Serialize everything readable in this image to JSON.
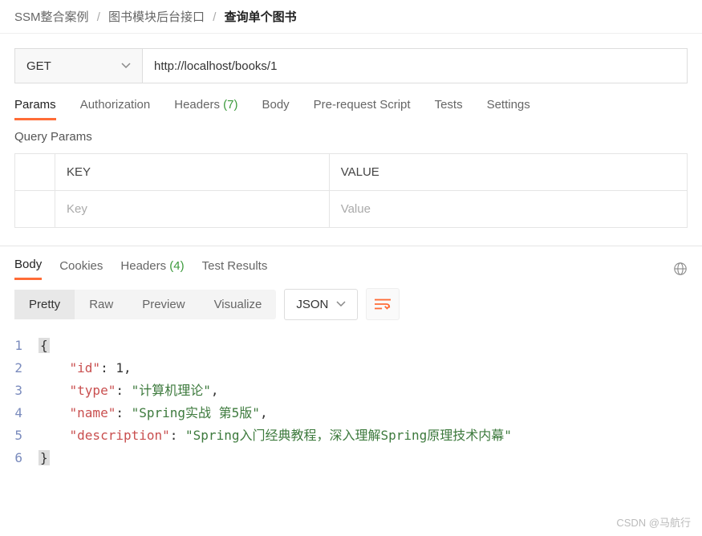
{
  "breadcrumb": {
    "level1": "SSM整合案例",
    "level2": "图书模块后台接口",
    "current": "查询单个图书"
  },
  "request": {
    "method": "GET",
    "url": "http://localhost/books/1"
  },
  "reqTabs": {
    "params": "Params",
    "auth": "Authorization",
    "headers": "Headers",
    "headers_count": "(7)",
    "body": "Body",
    "prereq": "Pre-request Script",
    "tests": "Tests",
    "settings": "Settings"
  },
  "sectionLabel": "Query Params",
  "paramsTable": {
    "keyHeader": "KEY",
    "valueHeader": "VALUE",
    "keyPlaceholder": "Key",
    "valuePlaceholder": "Value"
  },
  "respTabs": {
    "body": "Body",
    "cookies": "Cookies",
    "headers": "Headers",
    "headers_count": "(4)",
    "tests": "Test Results"
  },
  "viewTabs": {
    "pretty": "Pretty",
    "raw": "Raw",
    "preview": "Preview",
    "visualize": "Visualize"
  },
  "formatSelect": "JSON",
  "responseBody": {
    "id_key": "\"id\"",
    "id_val": "1",
    "type_key": "\"type\"",
    "type_val": "\"计算机理论\"",
    "name_key": "\"name\"",
    "name_val": "\"Spring实战 第5版\"",
    "desc_key": "\"description\"",
    "desc_val": "\"Spring入门经典教程，深入理解Spring原理技术内幕\""
  },
  "lineNums": {
    "l1": "1",
    "l2": "2",
    "l3": "3",
    "l4": "4",
    "l5": "5",
    "l6": "6"
  },
  "watermark": "CSDN @马航行"
}
